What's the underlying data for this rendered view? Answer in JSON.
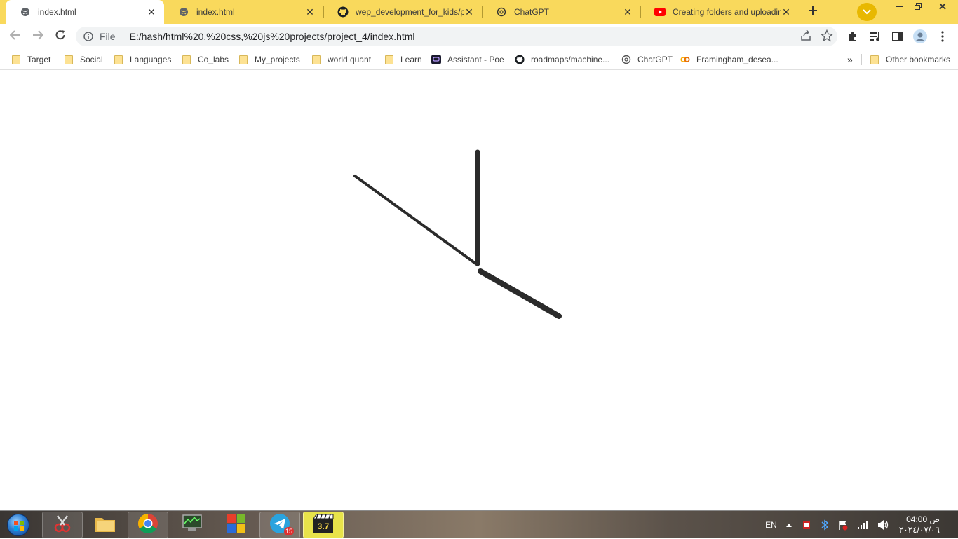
{
  "browser": {
    "tabs": [
      {
        "title": "index.html",
        "icon": "globe-icon",
        "active": true
      },
      {
        "title": "index.html",
        "icon": "globe-icon",
        "active": false
      },
      {
        "title": "wep_development_for_kids/pr",
        "icon": "github-icon",
        "active": false
      },
      {
        "title": "ChatGPT",
        "icon": "openai-icon",
        "active": false
      },
      {
        "title": "Creating folders and uploadinc",
        "icon": "youtube-icon",
        "active": false
      }
    ],
    "omnibox": {
      "scheme_label": "File",
      "url": "E:/hash/html%20,%20css,%20js%20projects/project_4/index.html"
    },
    "bookmarks": [
      {
        "label": "Target",
        "icon": "folder-icon"
      },
      {
        "label": "Social",
        "icon": "folder-icon"
      },
      {
        "label": "Languages",
        "icon": "folder-icon"
      },
      {
        "label": "Co_labs",
        "icon": "folder-icon"
      },
      {
        "label": "My_projects",
        "icon": "folder-icon"
      },
      {
        "label": "world quant",
        "icon": "folder-icon"
      },
      {
        "label": "Learn",
        "icon": "folder-icon"
      },
      {
        "label": "Assistant - Poe",
        "icon": "poe-icon"
      },
      {
        "label": "roadmaps/machine...",
        "icon": "github-icon"
      },
      {
        "label": "ChatGPT",
        "icon": "openai-icon"
      },
      {
        "label": "Framingham_desea...",
        "icon": "colab-icon"
      }
    ],
    "overflow_label": "»",
    "other_bookmarks": "Other bookmarks"
  },
  "page": {
    "content": "analog clock hands (no face)",
    "hand_color": "#2b2b2b"
  },
  "taskbar": {
    "apps": [
      "snipping-tool-icon",
      "file-explorer-icon",
      "chrome-icon",
      "system-monitor-icon",
      "office-icon",
      "telegram-icon",
      "media-player-icon"
    ],
    "telegram_badge": "15",
    "language": "EN",
    "time": "04:00 ص",
    "date": "٢٠٢٤/٠٧/٠٦"
  }
}
